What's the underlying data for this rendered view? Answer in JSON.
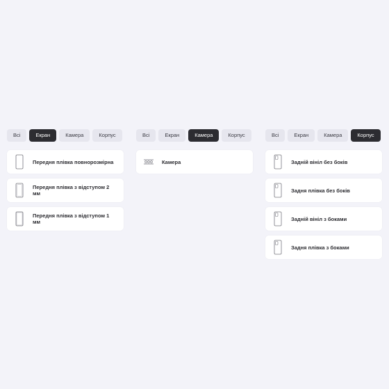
{
  "panels": [
    {
      "tabs": [
        {
          "label": "Всі",
          "active": false
        },
        {
          "label": "Екран",
          "active": true
        },
        {
          "label": "Камера",
          "active": false
        },
        {
          "label": "Корпус",
          "active": false
        }
      ],
      "items": [
        {
          "label": "Передня плівка повнорозмірна",
          "icon": "phone-outline-icon"
        },
        {
          "label": "Передня плівка з відступом 2 мм",
          "icon": "phone-outline-icon"
        },
        {
          "label": "Передня плівка з відступом 1 мм",
          "icon": "phone-outline-icon"
        }
      ]
    },
    {
      "tabs": [
        {
          "label": "Всі",
          "active": false
        },
        {
          "label": "Екран",
          "active": false
        },
        {
          "label": "Камера",
          "active": true
        },
        {
          "label": "Корпус",
          "active": false
        }
      ],
      "items": [
        {
          "label": "Камера",
          "icon": "camera-lens-icon"
        }
      ]
    },
    {
      "tabs": [
        {
          "label": "Всі",
          "active": false
        },
        {
          "label": "Екран",
          "active": false
        },
        {
          "label": "Камера",
          "active": false
        },
        {
          "label": "Корпус",
          "active": true
        }
      ],
      "items": [
        {
          "label": "Задній вініл без боків",
          "icon": "phone-back-icon"
        },
        {
          "label": "Задня плівка без боків",
          "icon": "phone-back-icon"
        },
        {
          "label": "Задній вініл з боками",
          "icon": "phone-back-icon"
        },
        {
          "label": "Задня плівка з боками",
          "icon": "phone-back-icon"
        }
      ]
    }
  ],
  "colors": {
    "background": "#f3f3f9",
    "tab_inactive": "#e6e6ee",
    "tab_active": "#2c2c31",
    "card": "#ffffff"
  }
}
